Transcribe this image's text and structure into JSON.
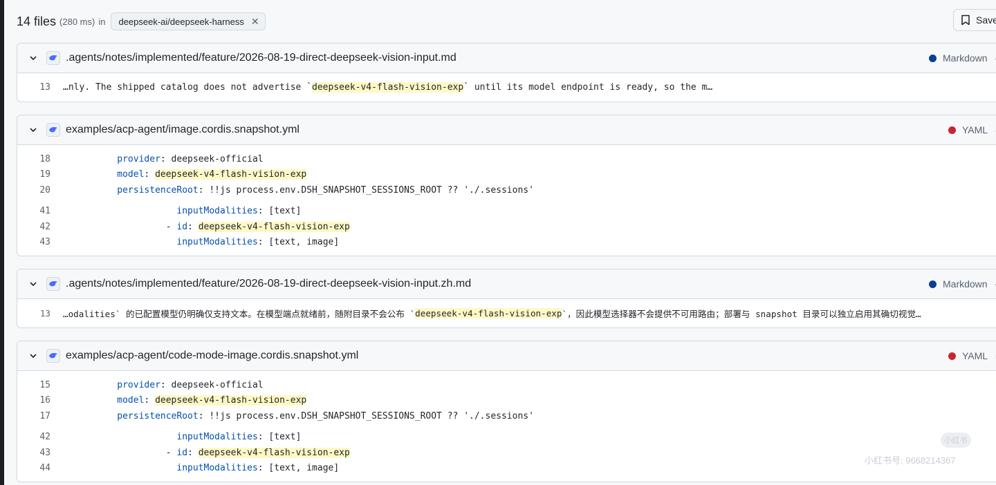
{
  "header": {
    "count": "14 files",
    "timing": "(280 ms)",
    "in_word": "in",
    "repo": "deepseek-ai/deepseek-harness",
    "save_label": "Save"
  },
  "colors": {
    "markdown": "#0c3e94",
    "yaml": "#cb2431",
    "highlight": "#fff8c5"
  },
  "results": [
    {
      "path": ".agents/notes/implemented/feature/2026-08-19-direct-deepseek-vision-input.md",
      "language": "Markdown",
      "lines": [
        {
          "n": "13",
          "pre": "…nly. The shipped catalog does not advertise `",
          "hl": "deepseek-v4-flash-vision-exp",
          "post": "` until its model endpoint is ready, so the m…"
        }
      ]
    },
    {
      "path": "examples/acp-agent/image.cordis.snapshot.yml",
      "language": "YAML",
      "lines": [
        {
          "n": "18",
          "indent": "          ",
          "key": "provider",
          "pre": ": deepseek-official"
        },
        {
          "n": "19",
          "indent": "          ",
          "key": "model",
          "pre": ": ",
          "hl": "deepseek-v4-flash-vision-exp"
        },
        {
          "n": "20",
          "indent": "          ",
          "key": "persistenceRoot",
          "pre": ": !!js process.env.DSH_SNAPSHOT_SESSIONS_ROOT ?? './.sessions'"
        },
        {
          "n": "41",
          "indent": "                     ",
          "key": "inputModalities",
          "pre": ": [text]"
        },
        {
          "n": "42",
          "indent": "                   - ",
          "key": "id",
          "pre": ": ",
          "hl": "deepseek-v4-flash-vision-exp"
        },
        {
          "n": "43",
          "indent": "                     ",
          "key": "inputModalities",
          "pre": ": [text, image]"
        }
      ]
    },
    {
      "path": ".agents/notes/implemented/feature/2026-08-19-direct-deepseek-vision-input.zh.md",
      "language": "Markdown",
      "lines": [
        {
          "n": "13",
          "pre": "…odalities` 的已配置模型仍明确仅支持文本。在模型端点就绪前，随附目录不会公布 `",
          "hl": "deepseek-v4-flash-vision-exp",
          "post": "`，因此模型选择器不会提供不可用路由；部署与 snapshot 目录可以独立启用其确切视觉…"
        }
      ]
    },
    {
      "path": "examples/acp-agent/code-mode-image.cordis.snapshot.yml",
      "language": "YAML",
      "lines": [
        {
          "n": "15",
          "indent": "          ",
          "key": "provider",
          "pre": ": deepseek-official"
        },
        {
          "n": "16",
          "indent": "          ",
          "key": "model",
          "pre": ": ",
          "hl": "deepseek-v4-flash-vision-exp"
        },
        {
          "n": "17",
          "indent": "          ",
          "key": "persistenceRoot",
          "pre": ": !!js process.env.DSH_SNAPSHOT_SESSIONS_ROOT ?? './.sessions'"
        },
        {
          "n": "42",
          "indent": "                     ",
          "key": "inputModalities",
          "pre": ": [text]"
        },
        {
          "n": "43",
          "indent": "                   - ",
          "key": "id",
          "pre": ": ",
          "hl": "deepseek-v4-flash-vision-exp"
        },
        {
          "n": "44",
          "indent": "                     ",
          "key": "inputModalities",
          "pre": ": [text, image]"
        }
      ]
    }
  ],
  "watermark": "小红书号: 9668214367",
  "watermark_badge": "小红书"
}
